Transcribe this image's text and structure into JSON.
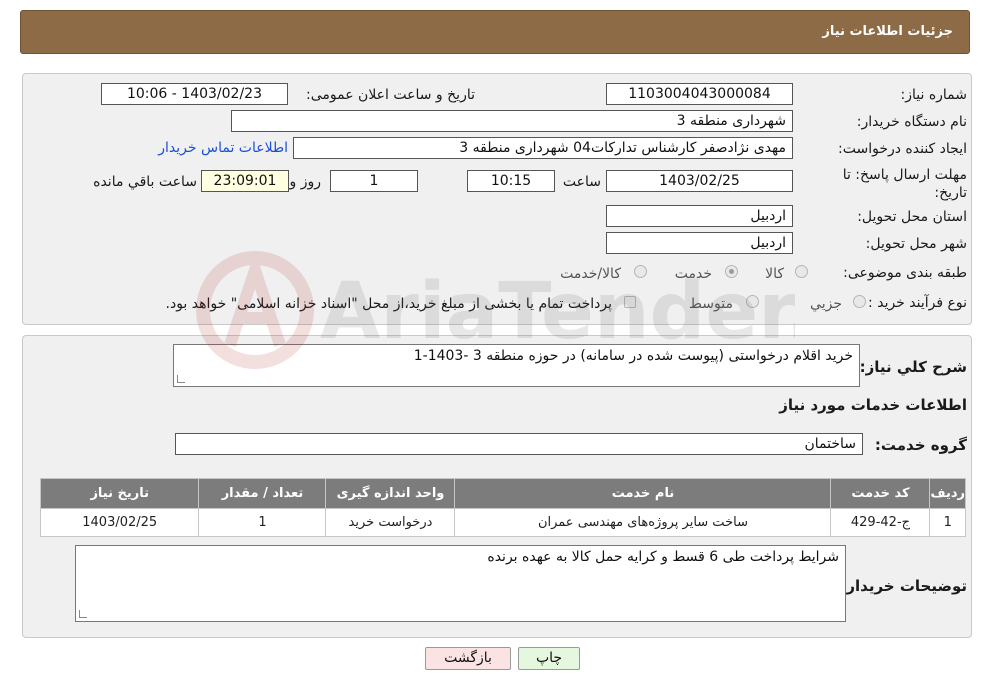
{
  "header": {
    "title": "جزئیات اطلاعات نیاز"
  },
  "form": {
    "need_number_label": "شماره نیاز:",
    "need_number_value": "1103004043000084",
    "announce_label": "تاریخ و ساعت اعلان عمومی:",
    "announce_value": "1403/02/23 - 10:06",
    "buyer_org_label": "نام دستگاه خریدار:",
    "buyer_org_value": "شهرداری منطقه 3",
    "creator_label": "ایجاد کننده درخواست:",
    "creator_value": "مهدی نژادصفر کارشناس تدارکات04 شهرداری منطقه 3",
    "contact_link": "اطلاعات تماس خریدار",
    "deadline_label": "مهلت ارسال پاسخ: تا تاریخ:",
    "deadline_date": "1403/02/25",
    "deadline_time_label": "ساعت",
    "deadline_time": "10:15",
    "days_value": "1",
    "days_label": "روز و",
    "remaining_time": "23:09:01",
    "remaining_label": "ساعت باقي مانده",
    "province_label": "استان محل تحویل:",
    "province_value": "اردبیل",
    "city_label": "شهر محل تحویل:",
    "city_value": "اردبیل",
    "category_label": "طبقه بندی موضوعی:",
    "category_options": [
      "کالا",
      "خدمت",
      "کالا/خدمت"
    ],
    "category_selected": "خدمت",
    "process_label": "نوع فرآیند خرید :",
    "process_options": [
      "جزیي",
      "متوسط"
    ],
    "payment_note": "پرداخت تمام یا بخشی از مبلغ خرید،از محل \"اسناد خزانه اسلامی\" خواهد بود."
  },
  "details": {
    "summary_label": "شرح کلي نياز:",
    "summary_value": "خرید اقلام درخواستی (پیوست شده در سامانه) در حوزه منطقه 3 -1403-1",
    "services_heading": "اطلاعات خدمات مورد نیاز",
    "service_group_label": "گروه خدمت:",
    "service_group_value": "ساختمان",
    "table": {
      "headers": [
        "ردیف",
        "کد خدمت",
        "نام خدمت",
        "واحد اندازه گیری",
        "تعداد / مقدار",
        "تاریخ نیاز"
      ],
      "rows": [
        [
          "1",
          "ج-42-429",
          "ساخت سایر پروژه‌های مهندسی عمران",
          "درخواست خرید",
          "1",
          "1403/02/25"
        ]
      ]
    },
    "buyer_notes_label": "توضیحات خریدار:",
    "buyer_notes_value": "شرایط پرداخت طی 6 قسط و کرایه حمل کالا به عهده برنده"
  },
  "buttons": {
    "print": "چاپ",
    "back": "بازگشت"
  },
  "colors": {
    "header_bg": "#8c6b46",
    "table_header_bg": "#7c7c7c",
    "back_btn_bg": "#fbe3e3",
    "print_btn_bg": "#e6f7df"
  }
}
